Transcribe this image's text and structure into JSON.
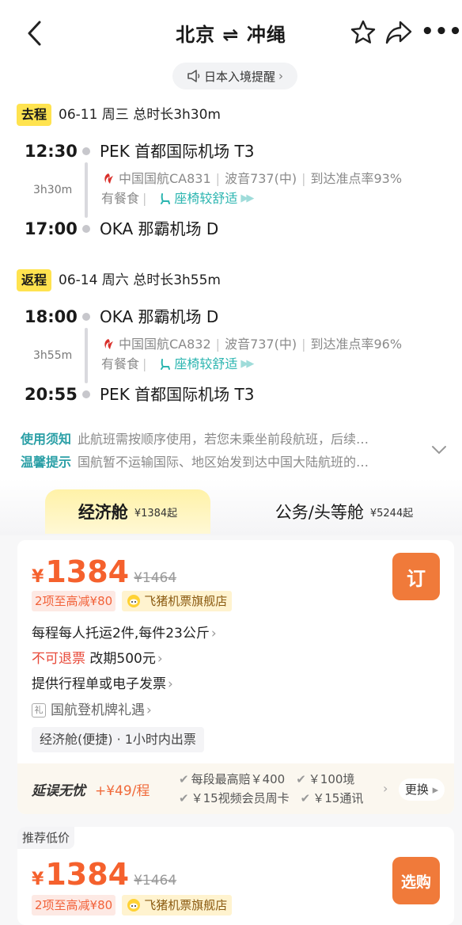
{
  "nav": {
    "title": "北京 ⇌ 冲绳",
    "more": "•••"
  },
  "notice": {
    "label": "日本入境提醒",
    "chevron": "›"
  },
  "outbound": {
    "tag": "去程",
    "date_line": "06-11 周三 总时长3h30m",
    "dep_time": "12:30",
    "dep_airport": "PEK 首都国际机场 T3",
    "duration": "3h30m",
    "airline": "中国国航CA831",
    "aircraft": "波音737(中)",
    "on_time": "到达准点率93%",
    "meal": "有餐食",
    "seat": "座椅较舒适",
    "arr_time": "17:00",
    "arr_airport": "OKA 那霸机场 D"
  },
  "inbound": {
    "tag": "返程",
    "date_line": "06-14 周六 总时长3h55m",
    "dep_time": "18:00",
    "dep_airport": "OKA 那霸机场 D",
    "duration": "3h55m",
    "airline": "中国国航CA832",
    "aircraft": "波音737(中)",
    "on_time": "到达准点率96%",
    "meal": "有餐食",
    "seat": "座椅较舒适",
    "arr_time": "20:55",
    "arr_airport": "PEK 首都国际机场 T3"
  },
  "tips": {
    "usage_key": "使用须知",
    "usage_text": "此航班需按顺序使用，若您未乘坐前段航班，后续…",
    "warm_key": "温馨提示",
    "warm_text": "国航暂不运输国际、地区始发到达中国大陆航班的…"
  },
  "cabins": {
    "economy_label": "经济舱",
    "economy_price": "¥1384起",
    "business_label": "公务/头等舱",
    "business_price": "¥5244起"
  },
  "offer1": {
    "currency": "¥",
    "price": "1384",
    "orig_price": "¥1464",
    "book_label": "订",
    "discount": "2项至高减¥80",
    "store": "飞猪机票旗舰店",
    "baggage": "每程每人托运2件,每件23公斤",
    "no_refund": "不可退票",
    "change_fee": "改期500元",
    "invoice": "提供行程单或电子发票",
    "gift_icon": "礼",
    "gift": "国航登机牌礼遇",
    "cabin_info": "经济舱(便捷) · 1小时内出票",
    "delay_title": "延误无忧",
    "delay_price": "+¥49/程",
    "benefit1": "每段最高赔￥400",
    "benefit2": "￥100境",
    "benefit3": "￥15视频会员周卡",
    "benefit4": "￥15通讯",
    "change_label": "更换"
  },
  "offer2": {
    "tag": "推荐低价",
    "currency": "¥",
    "price": "1384",
    "orig_price": "¥1464",
    "book_label": "选购",
    "discount": "2项至高减¥80",
    "store": "飞猪机票旗舰店"
  },
  "colors": {
    "accent_orange": "#f07a3a",
    "price_red": "#f5612d",
    "tag_yellow": "#ffe34f",
    "teal": "#2a9fa6"
  }
}
